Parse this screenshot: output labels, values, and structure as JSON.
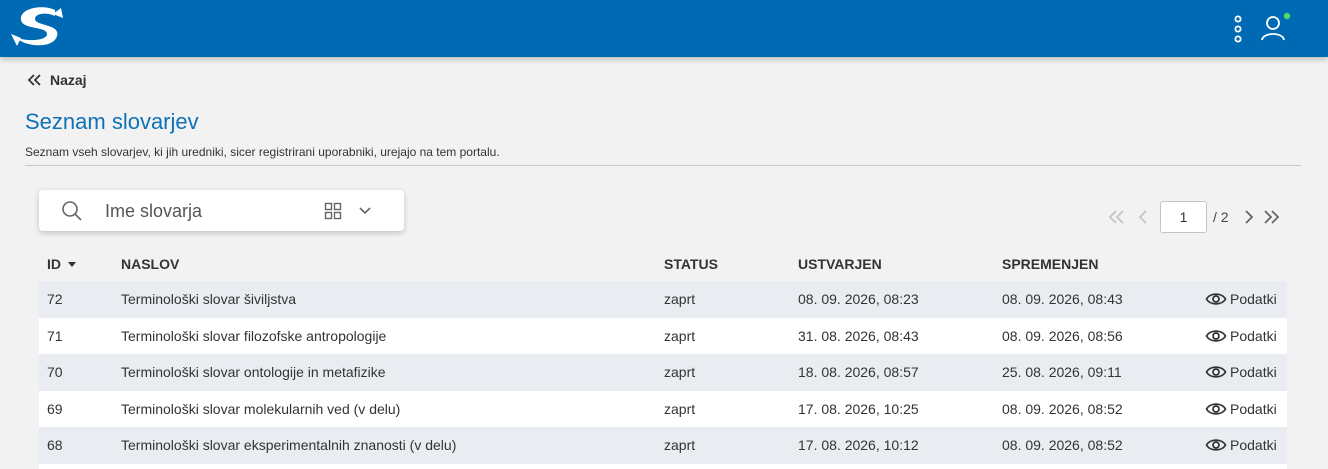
{
  "header": {
    "logo_icon": "s-logo-icon",
    "menu_icon": "kebab-menu-icon",
    "user_icon": "user-icon",
    "status_dot_color": "#4cd964",
    "bar_color": "#0069b4"
  },
  "back": {
    "label": "Nazaj",
    "icon": "double-chevron-left-icon"
  },
  "page": {
    "title": "Seznam slovarjev",
    "subtitle": "Seznam vseh slovarjev, ki jih uredniki, sicer registrirani uporabniki, urejajo na tem portalu."
  },
  "search": {
    "placeholder": "Ime slovarja",
    "value": "",
    "icon": "search-icon",
    "view_icon": "grid-view-icon",
    "dropdown_icon": "chevron-down-icon"
  },
  "pagination": {
    "current": "1",
    "total_label": "/ 2"
  },
  "table": {
    "headers": {
      "id": "ID",
      "title": "NASLOV",
      "status": "STATUS",
      "created": "USTVARJEN",
      "modified": "SPREMENJEN"
    },
    "sort": {
      "column": "id",
      "direction": "desc"
    },
    "action_label": "Podatki",
    "rows": [
      {
        "id": "72",
        "title": "Terminološki slovar šiviljstva",
        "status": "zaprt",
        "created": "08. 09. 2026, 08:23",
        "modified": "08. 09. 2026, 08:43"
      },
      {
        "id": "71",
        "title": "Terminološki slovar filozofske antropologije",
        "status": "zaprt",
        "created": "31. 08. 2026, 08:43",
        "modified": "08. 09. 2026, 08:56"
      },
      {
        "id": "70",
        "title": "Terminološki slovar ontologije in metafizike",
        "status": "zaprt",
        "created": "18. 08. 2026, 08:57",
        "modified": "25. 08. 2026, 09:11"
      },
      {
        "id": "69",
        "title": "Terminološki slovar molekularnih ved (v delu)",
        "status": "zaprt",
        "created": "17. 08. 2026, 10:25",
        "modified": "08. 09. 2026, 08:52"
      },
      {
        "id": "68",
        "title": "Terminološki slovar eksperimentalnih znanosti (v delu)",
        "status": "zaprt",
        "created": "17. 08. 2026, 10:12",
        "modified": "08. 09. 2026, 08:52"
      }
    ]
  }
}
